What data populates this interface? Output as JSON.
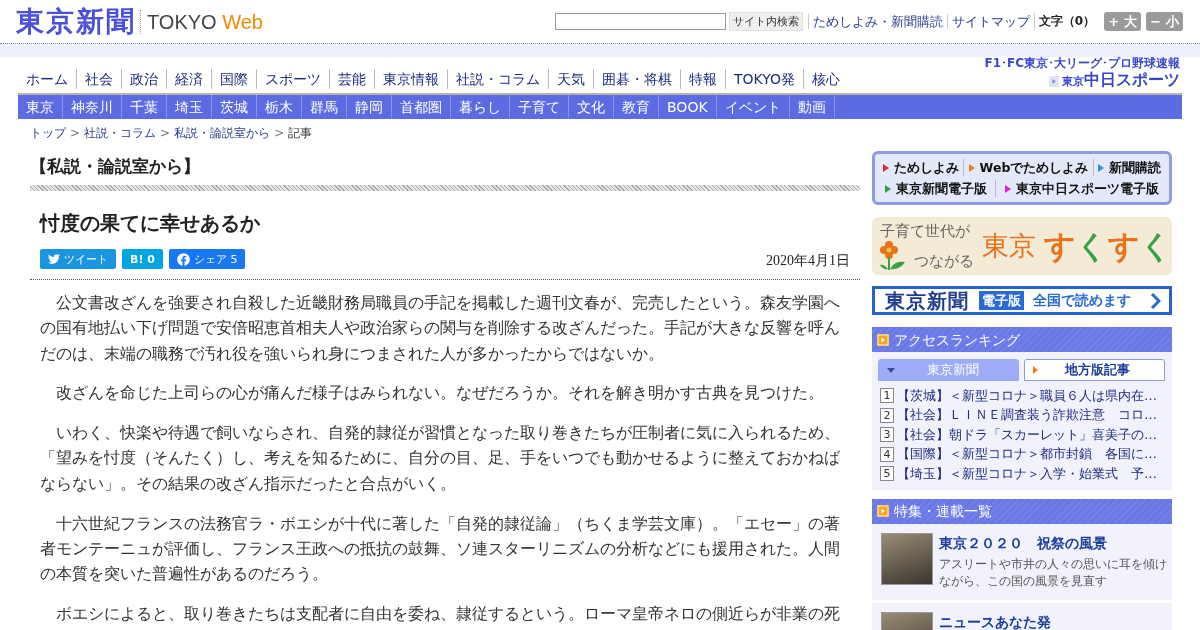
{
  "header": {
    "logo": "東京新聞",
    "site_name": "TOKYO",
    "site_name_accent": "Web",
    "search_button": "サイト内検索",
    "links": [
      "ためしよみ・新聞購読",
      "サイトマップ"
    ],
    "font_size_label": "文字（0）",
    "font_size_buttons": [
      "+ 大",
      "− 小"
    ]
  },
  "nav": {
    "primary": [
      "ホーム",
      "社会",
      "政治",
      "経済",
      "国際",
      "スポーツ",
      "芸能",
      "東京情報",
      "社説・コラム",
      "天気",
      "囲碁・将棋",
      "特報",
      "TOKYO発",
      "核心"
    ],
    "sports": {
      "caption": "F1･FC東京･大リーグ･プロ野球速報",
      "logo_prefix": "東京",
      "logo": "中日スポーツ"
    },
    "regional": [
      "東京",
      "神奈川",
      "千葉",
      "埼玉",
      "茨城",
      "栃木",
      "群馬",
      "静岡",
      "首都圏",
      "暮らし",
      "子育て",
      "文化",
      "教育",
      "BOOK",
      "イベント",
      "動画"
    ]
  },
  "breadcrumb": {
    "separator": ">",
    "items": [
      "トップ",
      "社説・コラム",
      "私説・論説室から",
      "記事"
    ]
  },
  "article": {
    "section": "【私説・論説室から】",
    "title": "忖度の果てに幸せあるか",
    "share": [
      {
        "kind": "twitter",
        "label": "ツイート"
      },
      {
        "kind": "hatena",
        "label": "B!",
        "count": "0"
      },
      {
        "kind": "facebook",
        "label": "シェア",
        "count": "5"
      }
    ],
    "date": "2020年4月1日",
    "paragraphs": [
      "公文書改ざんを強要され自殺した近畿財務局職員の手記を掲載した週刊文春が、完売したという。森友学園への国有地払い下げ問題で安倍昭恵首相夫人や政治家らの関与を削除する改ざんだった。手記が大きな反響を呼んだのは、末端の職務で汚れ役を強いられ身につまされた人が多かったからではないか。",
      "改ざんを命じた上司らの心が痛んだ様子はみられない。なぜだろうか。それを解き明かす古典を見つけた。",
      "いわく、快楽や待遇で飼いならされ、自発的隷従が習慣となった取り巻きたちが圧制者に気に入られるため、「望みを忖度（そんたく）し、考えを知るために、自分の目、足、手をいつでも動かせるように整えておかねばならない」。その結果の改ざん指示だったと合点がいく。",
      "十六世紀フランスの法務官ラ・ボエシが十代に著した「自発的隷従論」（ちくま学芸文庫）。「エセー」の著者モンテーニュが評価し、フランス王政への抵抗の鼓舞、ソ連スターリニズムの分析などにも援用された。人間の本質を突いた普遍性があるのだろう。",
      "ボエシによると、取り巻きたちは支配者に自由を委ね、隷従するという。ローマ皇帝ネロの側近らが非業の死"
    ]
  },
  "sidebar": {
    "promo": {
      "rows": [
        [
          {
            "label": "ためしよみ",
            "color": "#e3262e"
          },
          {
            "label": "Webでためしよみ",
            "color": "#ef7d1a"
          },
          {
            "label": "新聞購読",
            "color": "#2a9bd6"
          }
        ],
        [
          {
            "label": "東京新聞電子版",
            "color": "#2f9e4f"
          },
          {
            "label": "東京中日スポーツ電子版",
            "color": "#e11fd3"
          }
        ]
      ]
    },
    "sukusuku": {
      "tagline_1": "子育て世代が",
      "tagline_2": "つながる",
      "brand": "東京",
      "brand_accent": "すくすく"
    },
    "digital": {
      "logo": "東京新聞",
      "badge": "電子版",
      "text": "全国で読めます"
    },
    "ranking": {
      "title": "アクセスランキング",
      "tabs": [
        {
          "label": "東京新聞",
          "selected": true
        },
        {
          "label": "地方版記事",
          "selected": false
        }
      ],
      "items": [
        {
          "rank": "1",
          "text": "【茨城】＜新型コロナ＞職員６人は県内在…"
        },
        {
          "rank": "2",
          "text": "【社会】ＬＩＮＥ調査装う詐欺注意　コロ…"
        },
        {
          "rank": "3",
          "text": "【社会】朝ドラ「スカーレット」喜美子の…"
        },
        {
          "rank": "4",
          "text": "【国際】＜新型コロナ＞都市封鎖　各国に…"
        },
        {
          "rank": "5",
          "text": "【埼玉】＜新型コロナ＞入学・始業式　予…"
        }
      ]
    },
    "features": {
      "title": "特集・連載一覧",
      "items": [
        {
          "title": "東京２０２０　祝祭の風景",
          "description": "アスリートや市井の人々の思いに耳を傾けながら、この国の風景を見直す"
        },
        {
          "title": "ニュースあなた発"
        }
      ]
    }
  }
}
